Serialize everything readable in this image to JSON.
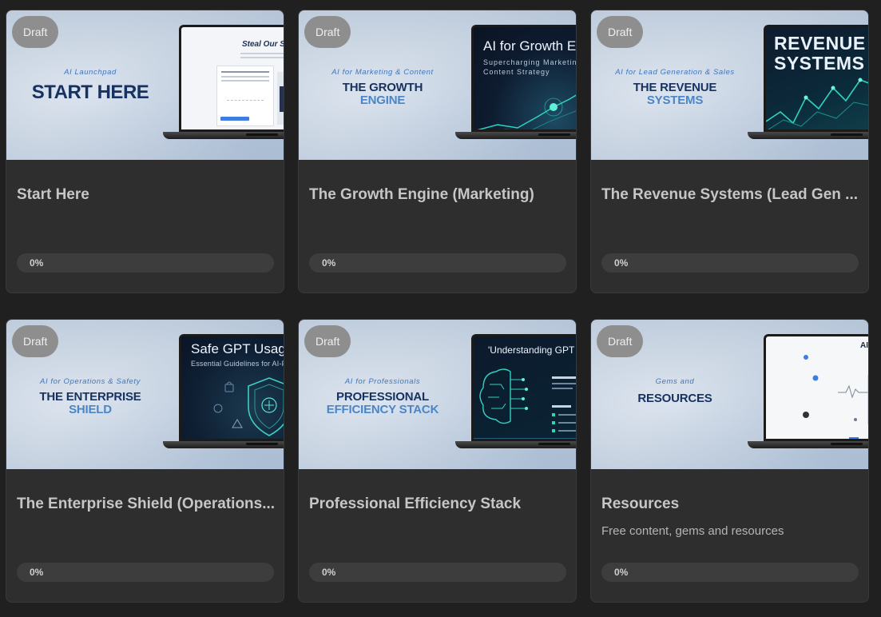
{
  "courses": [
    {
      "badge": "Draft",
      "hero_tagline": "AI Launchpad",
      "hero_title": "START HERE",
      "screen_title": "Steal Our Sys",
      "title": "Start Here",
      "progress": 0,
      "progress_label": "0%"
    },
    {
      "badge": "Draft",
      "hero_tagline": "AI for Marketing & Content",
      "hero_title_1": "THE GROWTH",
      "hero_title_2": "ENGINE",
      "screen_title": "AI for Growth E",
      "screen_subtitle": "Supercharging Marketing & Content Strategy",
      "title": "The Growth Engine (Marketing)",
      "progress": 0,
      "progress_label": "0%"
    },
    {
      "badge": "Draft",
      "hero_tagline": "AI for Lead Generation & Sales",
      "hero_title_1": "THE REVENUE",
      "hero_title_2": "SYSTEMS",
      "screen_title": "REVENUE SYSTEMS",
      "title": "The Revenue Systems (Lead Gen ...",
      "progress": 0,
      "progress_label": "0%"
    },
    {
      "badge": "Draft",
      "hero_tagline": "AI for Operations & Safety",
      "hero_title_1": "THE ENTERPRISE",
      "hero_title_2": "SHIELD",
      "screen_title": "Safe GPT Usage",
      "screen_subtitle": "Essential Guidelines for AI-Pow",
      "title": "The Enterprise Shield (Operations...",
      "progress": 0,
      "progress_label": "0%"
    },
    {
      "badge": "Draft",
      "hero_tagline": "AI for Professionals",
      "hero_title_1": "PROFESSIONAL",
      "hero_title_2": "EFFICIENCY STACK",
      "screen_title": "'Understanding GPT",
      "title": "Professional Efficiency Stack",
      "progress": 0,
      "progress_label": "0%"
    },
    {
      "badge": "Draft",
      "hero_tagline": "Gems and",
      "hero_title_1": "RESOURCES",
      "screen_title": "AI",
      "title": "Resources",
      "description": "Free content, gems and resources",
      "progress": 0,
      "progress_label": "0%"
    }
  ],
  "colors": {
    "background": "#202020",
    "card": "#2e2e2e",
    "brand_navy": "#17325f",
    "brand_blue": "#4a86c7",
    "circuit_teal": "#2fd3c0"
  }
}
